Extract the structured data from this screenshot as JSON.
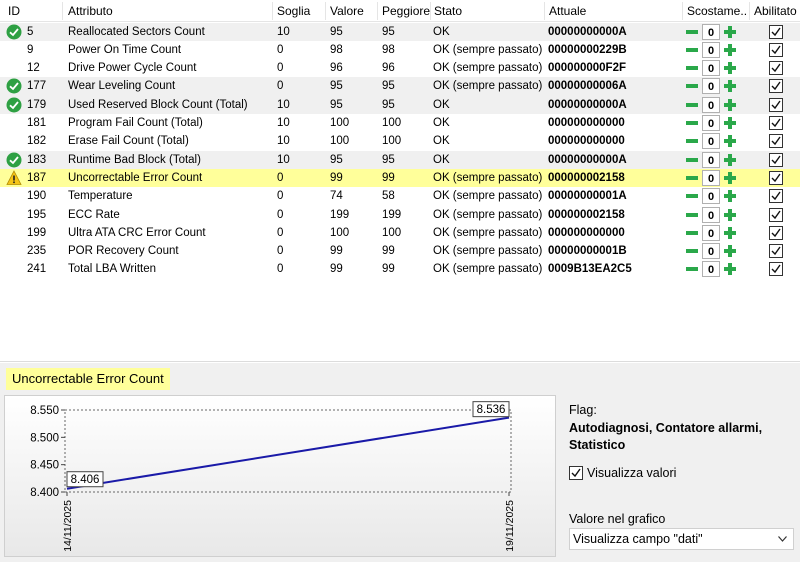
{
  "columns": {
    "id": "ID",
    "attribute": "Attributo",
    "threshold": "Soglia",
    "value": "Valore",
    "worst": "Peggiore",
    "status": "Stato",
    "current": "Attuale",
    "offset": "Scostame...",
    "enabled": "Abilitato"
  },
  "rows": [
    {
      "status_icon": "check-circle-icon",
      "id": "5",
      "attribute": "Reallocated Sectors Count",
      "threshold": "10",
      "value": "95",
      "worst": "95",
      "status": "OK",
      "current": "00000000000A",
      "offset": "0",
      "enabled": true,
      "shaded": true,
      "selected": false
    },
    {
      "status_icon": "",
      "id": "9",
      "attribute": "Power On Time Count",
      "threshold": "0",
      "value": "98",
      "worst": "98",
      "status": "OK (sempre passato)",
      "current": "00000000229B",
      "offset": "0",
      "enabled": true,
      "shaded": false,
      "selected": false
    },
    {
      "status_icon": "",
      "id": "12",
      "attribute": "Drive Power Cycle Count",
      "threshold": "0",
      "value": "96",
      "worst": "96",
      "status": "OK (sempre passato)",
      "current": "000000000F2F",
      "offset": "0",
      "enabled": true,
      "shaded": false,
      "selected": false
    },
    {
      "status_icon": "check-circle-icon",
      "id": "177",
      "attribute": "Wear Leveling Count",
      "threshold": "0",
      "value": "95",
      "worst": "95",
      "status": "OK (sempre passato)",
      "current": "00000000006A",
      "offset": "0",
      "enabled": true,
      "shaded": true,
      "selected": false
    },
    {
      "status_icon": "check-circle-icon",
      "id": "179",
      "attribute": "Used Reserved Block Count (Total)",
      "threshold": "10",
      "value": "95",
      "worst": "95",
      "status": "OK",
      "current": "00000000000A",
      "offset": "0",
      "enabled": true,
      "shaded": true,
      "selected": false
    },
    {
      "status_icon": "",
      "id": "181",
      "attribute": "Program Fail Count (Total)",
      "threshold": "10",
      "value": "100",
      "worst": "100",
      "status": "OK",
      "current": "000000000000",
      "offset": "0",
      "enabled": true,
      "shaded": false,
      "selected": false
    },
    {
      "status_icon": "",
      "id": "182",
      "attribute": "Erase Fail Count (Total)",
      "threshold": "10",
      "value": "100",
      "worst": "100",
      "status": "OK",
      "current": "000000000000",
      "offset": "0",
      "enabled": true,
      "shaded": false,
      "selected": false
    },
    {
      "status_icon": "check-circle-icon",
      "id": "183",
      "attribute": "Runtime Bad Block (Total)",
      "threshold": "10",
      "value": "95",
      "worst": "95",
      "status": "OK",
      "current": "00000000000A",
      "offset": "0",
      "enabled": true,
      "shaded": true,
      "selected": false
    },
    {
      "status_icon": "warning-triangle-icon",
      "id": "187",
      "attribute": "Uncorrectable Error Count",
      "threshold": "0",
      "value": "99",
      "worst": "99",
      "status": "OK (sempre passato)",
      "current": "000000002158",
      "offset": "0",
      "enabled": true,
      "shaded": false,
      "selected": true
    },
    {
      "status_icon": "",
      "id": "190",
      "attribute": "Temperature",
      "threshold": "0",
      "value": "74",
      "worst": "58",
      "status": "OK (sempre passato)",
      "current": "00000000001A",
      "offset": "0",
      "enabled": true,
      "shaded": false,
      "selected": false
    },
    {
      "status_icon": "",
      "id": "195",
      "attribute": "ECC Rate",
      "threshold": "0",
      "value": "199",
      "worst": "199",
      "status": "OK (sempre passato)",
      "current": "000000002158",
      "offset": "0",
      "enabled": true,
      "shaded": false,
      "selected": false
    },
    {
      "status_icon": "",
      "id": "199",
      "attribute": "Ultra ATA CRC Error Count",
      "threshold": "0",
      "value": "100",
      "worst": "100",
      "status": "OK (sempre passato)",
      "current": "000000000000",
      "offset": "0",
      "enabled": true,
      "shaded": false,
      "selected": false
    },
    {
      "status_icon": "",
      "id": "235",
      "attribute": "POR Recovery Count",
      "threshold": "0",
      "value": "99",
      "worst": "99",
      "status": "OK (sempre passato)",
      "current": "00000000001B",
      "offset": "0",
      "enabled": true,
      "shaded": false,
      "selected": false
    },
    {
      "status_icon": "",
      "id": "241",
      "attribute": "Total LBA Written",
      "threshold": "0",
      "value": "99",
      "worst": "99",
      "status": "OK (sempre passato)",
      "current": "0009B13EA2C5",
      "offset": "0",
      "enabled": true,
      "shaded": false,
      "selected": false
    }
  ],
  "graph": {
    "title": "Uncorrectable Error Count"
  },
  "chart_data": {
    "type": "line",
    "x": [
      "14/11/2025",
      "19/11/2025"
    ],
    "series": [
      {
        "values": [
          8.406,
          8.536
        ],
        "labels": [
          "8.406",
          "8.536"
        ]
      }
    ],
    "y_ticks": [
      "8.550",
      "8.500",
      "8.450",
      "8.400"
    ],
    "y_tick_values": [
      8.55,
      8.5,
      8.45,
      8.4
    ],
    "ylim": [
      8.4,
      8.55
    ],
    "line_color": "#1a1aa8",
    "grid": false
  },
  "side": {
    "flag_label": "Flag:",
    "flag_value": "Autodiagnosi, Contatore allarmi, Statistico",
    "show_values_label": "Visualizza valori",
    "show_values_checked": true,
    "graph_value_label": "Valore nel grafico",
    "graph_value_selected": "Visualizza campo \"dati\""
  },
  "colors": {
    "ok_green": "#2ea043",
    "warning_yellow": "#f5c518",
    "highlight": "#ffff9a",
    "stepper_green": "#2aa84a"
  }
}
